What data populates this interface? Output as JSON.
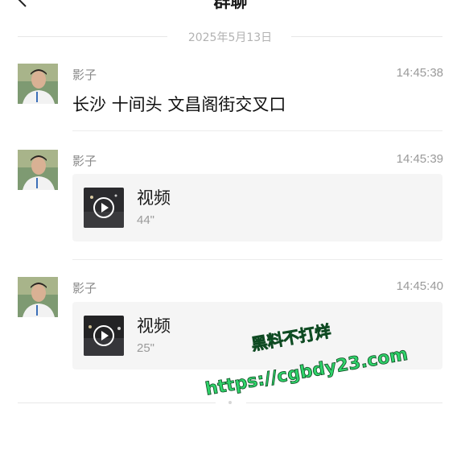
{
  "header": {
    "title": "群聊"
  },
  "date_separator": "2025年5月13日",
  "messages": [
    {
      "sender": "影子",
      "time": "14:45:38",
      "type": "text",
      "text": "长沙 十间头 文昌阁街交叉口"
    },
    {
      "sender": "影子",
      "time": "14:45:39",
      "type": "video",
      "video_label": "视频",
      "duration": "44\""
    },
    {
      "sender": "影子",
      "time": "14:45:40",
      "type": "video",
      "video_label": "视频",
      "duration": "25\""
    }
  ],
  "watermark": {
    "line1": "黑料不打烊",
    "line2": "https://cgbdy23.com",
    "color": "#2fd36a"
  },
  "colors": {
    "card_bg": "#f5f5f5",
    "meta_text": "#9a9a9a",
    "divider": "#ececec"
  }
}
